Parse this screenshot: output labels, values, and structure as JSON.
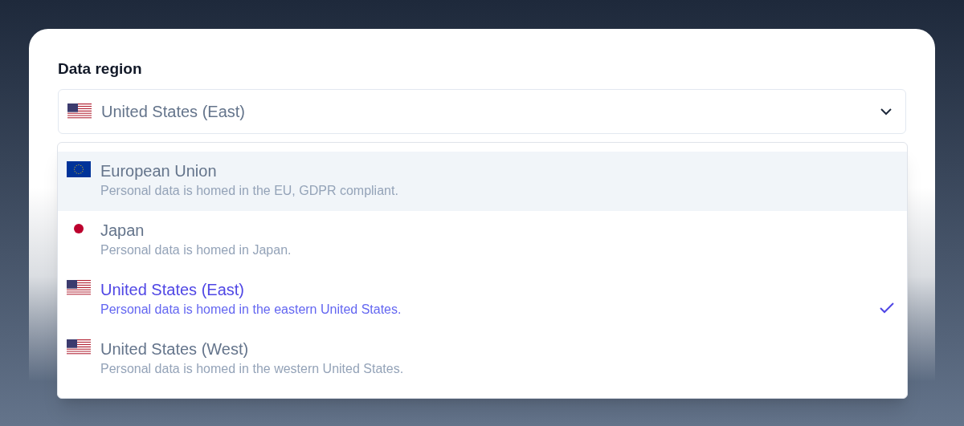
{
  "label": "Data region",
  "select": {
    "value": "United States (East)",
    "kind": "us"
  },
  "options": [
    {
      "name": "European Union",
      "description": "Personal data is homed in the EU, GDPR compliant.",
      "kind": "eu",
      "highlighted": true,
      "selected": false
    },
    {
      "name": "Japan",
      "description": "Personal data is homed in Japan.",
      "kind": "jp",
      "highlighted": false,
      "selected": false
    },
    {
      "name": "United States (East)",
      "description": "Personal data is homed in the eastern United States.",
      "kind": "us",
      "highlighted": false,
      "selected": true
    },
    {
      "name": "United States (West)",
      "description": "Personal data is homed in the western United States.",
      "kind": "us",
      "highlighted": false,
      "selected": false
    }
  ]
}
